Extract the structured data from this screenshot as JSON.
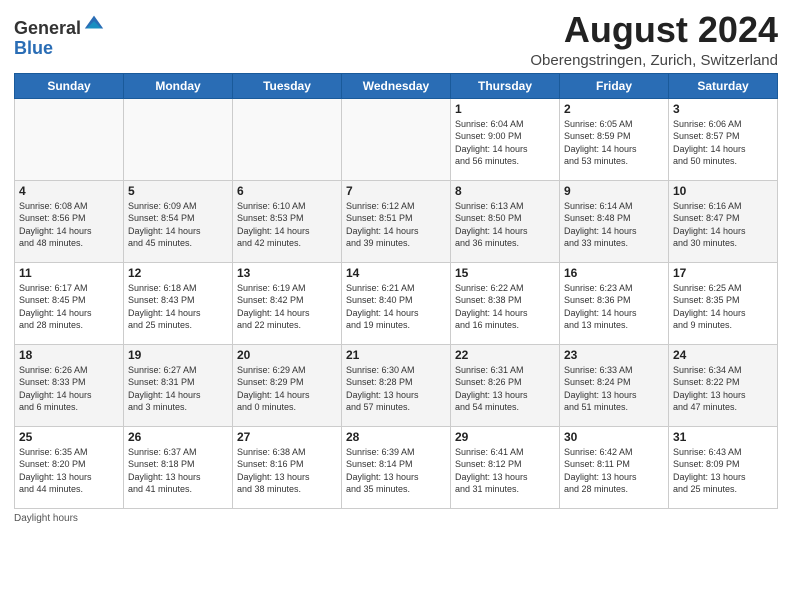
{
  "header": {
    "title": "August 2024",
    "subtitle": "Oberengstringen, Zurich, Switzerland"
  },
  "calendar": {
    "headers": [
      "Sunday",
      "Monday",
      "Tuesday",
      "Wednesday",
      "Thursday",
      "Friday",
      "Saturday"
    ],
    "weeks": [
      [
        {
          "day": "",
          "info": ""
        },
        {
          "day": "",
          "info": ""
        },
        {
          "day": "",
          "info": ""
        },
        {
          "day": "",
          "info": ""
        },
        {
          "day": "1",
          "info": "Sunrise: 6:04 AM\nSunset: 9:00 PM\nDaylight: 14 hours\nand 56 minutes."
        },
        {
          "day": "2",
          "info": "Sunrise: 6:05 AM\nSunset: 8:59 PM\nDaylight: 14 hours\nand 53 minutes."
        },
        {
          "day": "3",
          "info": "Sunrise: 6:06 AM\nSunset: 8:57 PM\nDaylight: 14 hours\nand 50 minutes."
        }
      ],
      [
        {
          "day": "4",
          "info": "Sunrise: 6:08 AM\nSunset: 8:56 PM\nDaylight: 14 hours\nand 48 minutes."
        },
        {
          "day": "5",
          "info": "Sunrise: 6:09 AM\nSunset: 8:54 PM\nDaylight: 14 hours\nand 45 minutes."
        },
        {
          "day": "6",
          "info": "Sunrise: 6:10 AM\nSunset: 8:53 PM\nDaylight: 14 hours\nand 42 minutes."
        },
        {
          "day": "7",
          "info": "Sunrise: 6:12 AM\nSunset: 8:51 PM\nDaylight: 14 hours\nand 39 minutes."
        },
        {
          "day": "8",
          "info": "Sunrise: 6:13 AM\nSunset: 8:50 PM\nDaylight: 14 hours\nand 36 minutes."
        },
        {
          "day": "9",
          "info": "Sunrise: 6:14 AM\nSunset: 8:48 PM\nDaylight: 14 hours\nand 33 minutes."
        },
        {
          "day": "10",
          "info": "Sunrise: 6:16 AM\nSunset: 8:47 PM\nDaylight: 14 hours\nand 30 minutes."
        }
      ],
      [
        {
          "day": "11",
          "info": "Sunrise: 6:17 AM\nSunset: 8:45 PM\nDaylight: 14 hours\nand 28 minutes."
        },
        {
          "day": "12",
          "info": "Sunrise: 6:18 AM\nSunset: 8:43 PM\nDaylight: 14 hours\nand 25 minutes."
        },
        {
          "day": "13",
          "info": "Sunrise: 6:19 AM\nSunset: 8:42 PM\nDaylight: 14 hours\nand 22 minutes."
        },
        {
          "day": "14",
          "info": "Sunrise: 6:21 AM\nSunset: 8:40 PM\nDaylight: 14 hours\nand 19 minutes."
        },
        {
          "day": "15",
          "info": "Sunrise: 6:22 AM\nSunset: 8:38 PM\nDaylight: 14 hours\nand 16 minutes."
        },
        {
          "day": "16",
          "info": "Sunrise: 6:23 AM\nSunset: 8:36 PM\nDaylight: 14 hours\nand 13 minutes."
        },
        {
          "day": "17",
          "info": "Sunrise: 6:25 AM\nSunset: 8:35 PM\nDaylight: 14 hours\nand 9 minutes."
        }
      ],
      [
        {
          "day": "18",
          "info": "Sunrise: 6:26 AM\nSunset: 8:33 PM\nDaylight: 14 hours\nand 6 minutes."
        },
        {
          "day": "19",
          "info": "Sunrise: 6:27 AM\nSunset: 8:31 PM\nDaylight: 14 hours\nand 3 minutes."
        },
        {
          "day": "20",
          "info": "Sunrise: 6:29 AM\nSunset: 8:29 PM\nDaylight: 14 hours\nand 0 minutes."
        },
        {
          "day": "21",
          "info": "Sunrise: 6:30 AM\nSunset: 8:28 PM\nDaylight: 13 hours\nand 57 minutes."
        },
        {
          "day": "22",
          "info": "Sunrise: 6:31 AM\nSunset: 8:26 PM\nDaylight: 13 hours\nand 54 minutes."
        },
        {
          "day": "23",
          "info": "Sunrise: 6:33 AM\nSunset: 8:24 PM\nDaylight: 13 hours\nand 51 minutes."
        },
        {
          "day": "24",
          "info": "Sunrise: 6:34 AM\nSunset: 8:22 PM\nDaylight: 13 hours\nand 47 minutes."
        }
      ],
      [
        {
          "day": "25",
          "info": "Sunrise: 6:35 AM\nSunset: 8:20 PM\nDaylight: 13 hours\nand 44 minutes."
        },
        {
          "day": "26",
          "info": "Sunrise: 6:37 AM\nSunset: 8:18 PM\nDaylight: 13 hours\nand 41 minutes."
        },
        {
          "day": "27",
          "info": "Sunrise: 6:38 AM\nSunset: 8:16 PM\nDaylight: 13 hours\nand 38 minutes."
        },
        {
          "day": "28",
          "info": "Sunrise: 6:39 AM\nSunset: 8:14 PM\nDaylight: 13 hours\nand 35 minutes."
        },
        {
          "day": "29",
          "info": "Sunrise: 6:41 AM\nSunset: 8:12 PM\nDaylight: 13 hours\nand 31 minutes."
        },
        {
          "day": "30",
          "info": "Sunrise: 6:42 AM\nSunset: 8:11 PM\nDaylight: 13 hours\nand 28 minutes."
        },
        {
          "day": "31",
          "info": "Sunrise: 6:43 AM\nSunset: 8:09 PM\nDaylight: 13 hours\nand 25 minutes."
        }
      ]
    ]
  },
  "footer": {
    "note": "Daylight hours"
  }
}
